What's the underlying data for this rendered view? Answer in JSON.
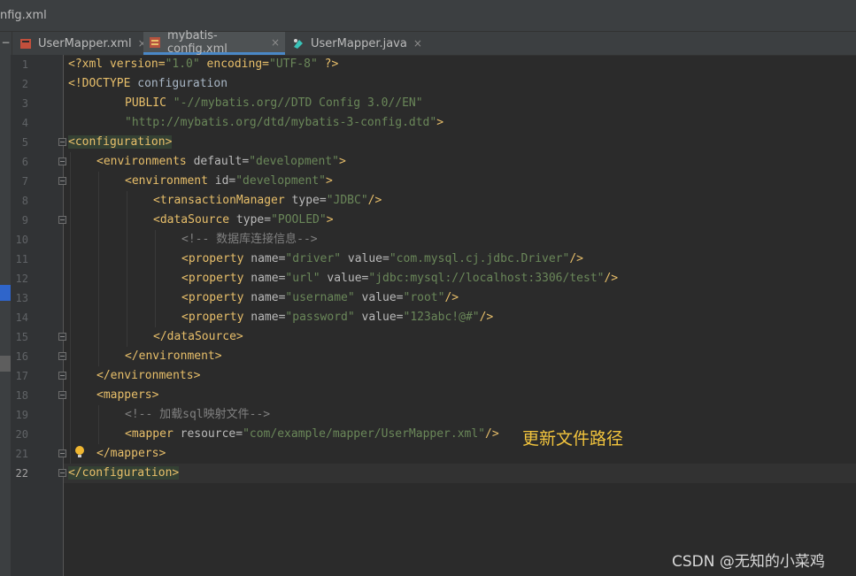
{
  "window": {
    "title": "nfig.xml"
  },
  "tabs": [
    {
      "label": "UserMapper.xml",
      "icon": "xml-file-icon",
      "close": "×",
      "active": false
    },
    {
      "label": "mybatis-config.xml",
      "icon": "mybatis-config-file-icon",
      "close": "×",
      "active": true
    },
    {
      "label": "UserMapper.java",
      "icon": "java-interface-icon",
      "close": "×",
      "active": false
    }
  ],
  "tab_nav": {
    "glyph": "−"
  },
  "editor": {
    "current_line": 22,
    "line_numbers": [
      "1",
      "2",
      "3",
      "4",
      "5",
      "6",
      "7",
      "8",
      "9",
      "10",
      "11",
      "12",
      "13",
      "14",
      "15",
      "16",
      "17",
      "18",
      "19",
      "20",
      "21",
      "22"
    ],
    "lines": {
      "l1": {
        "a": "<?xml version=",
        "b": "\"1.0\"",
        "c": " encoding=",
        "d": "\"UTF-8\"",
        "e": " ?>"
      },
      "l2": {
        "a": "<!DOCTYPE",
        "b": " configuration"
      },
      "l3": {
        "a": "PUBLIC",
        "b": " \"-//mybatis.org//DTD Config 3.0//EN\""
      },
      "l4": {
        "a": "\"http://mybatis.org/dtd/mybatis-3-config.dtd\"",
        "b": ">"
      },
      "l5": {
        "a": "<configuration>"
      },
      "l6": {
        "a": "<environments",
        "b": " default=",
        "c": "\"development\"",
        "d": ">"
      },
      "l7": {
        "a": "<environment",
        "b": " id=",
        "c": "\"development\"",
        "d": ">"
      },
      "l8": {
        "a": "<transactionManager",
        "b": " type=",
        "c": "\"JDBC\"",
        "d": "/>"
      },
      "l9": {
        "a": "<dataSource",
        "b": " type=",
        "c": "\"POOLED\"",
        "d": ">"
      },
      "l10": {
        "a": "<!-- 数据库连接信息-->"
      },
      "l11": {
        "a": "<property",
        "b": " name=",
        "c": "\"driver\"",
        "d": " value=",
        "e": "\"com.mysql.cj.jdbc.Driver\"",
        "f": "/>"
      },
      "l12": {
        "a": "<property",
        "b": " name=",
        "c": "\"url\"",
        "d": " value=",
        "e": "\"jdbc:mysql://localhost:3306/test\"",
        "f": "/>"
      },
      "l13": {
        "a": "<property",
        "b": " name=",
        "c": "\"username\"",
        "d": " value=",
        "e": "\"root\"",
        "f": "/>"
      },
      "l14": {
        "a": "<property",
        "b": " name=",
        "c": "\"password\"",
        "d": " value=",
        "e": "\"123abc!@#\"",
        "f": "/>"
      },
      "l15": {
        "a": "</dataSource>"
      },
      "l16": {
        "a": "</environment>"
      },
      "l17": {
        "a": "</environments>"
      },
      "l18": {
        "a": "<mappers>"
      },
      "l19": {
        "a": "<!-- 加载sql映射文件-->"
      },
      "l20": {
        "a": "<mapper",
        "b": " resource=",
        "c": "\"com/example/mapper/UserMapper.xml\"",
        "d": "/>"
      },
      "l21": {
        "a": "</mappers>"
      },
      "l22": {
        "a": "</configuration>"
      }
    }
  },
  "annotation": {
    "text": "更新文件路径",
    "color": "#f2c43d"
  },
  "watermark": {
    "text": "CSDN @无知的小菜鸡"
  },
  "colors": {
    "tag": "#e8bf6a",
    "attr_value": "#6a8759",
    "comment": "#808080",
    "text": "#a9b7c6",
    "background": "#2b2b2b"
  }
}
